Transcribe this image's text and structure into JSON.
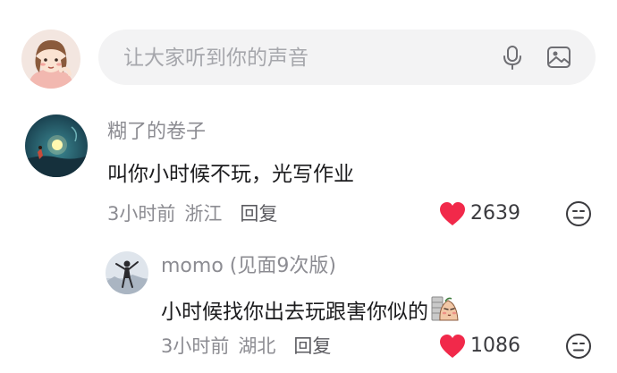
{
  "composer": {
    "placeholder": "让大家听到你的声音",
    "icons": [
      "mic-icon",
      "image-icon"
    ]
  },
  "comments": [
    {
      "username": "糊了的卷子",
      "text": "叫你小时候不玩，光写作业",
      "time": "3小时前",
      "location": "浙江",
      "reply_label": "回复",
      "likes": "2639",
      "liked": true
    }
  ],
  "replies": [
    {
      "username": "momo (见面9次版)",
      "text": "小时候找你出去玩跟害你似的",
      "sticker": "shy-face-sticker",
      "time": "3小时前",
      "location": "湖北",
      "reply_label": "回复",
      "likes": "1086",
      "liked": true
    }
  ],
  "colors": {
    "heart": "#f1294a",
    "secondary_text": "#8c8c92",
    "primary_text": "#1c1c1e",
    "input_bg": "#f3f3f4"
  }
}
